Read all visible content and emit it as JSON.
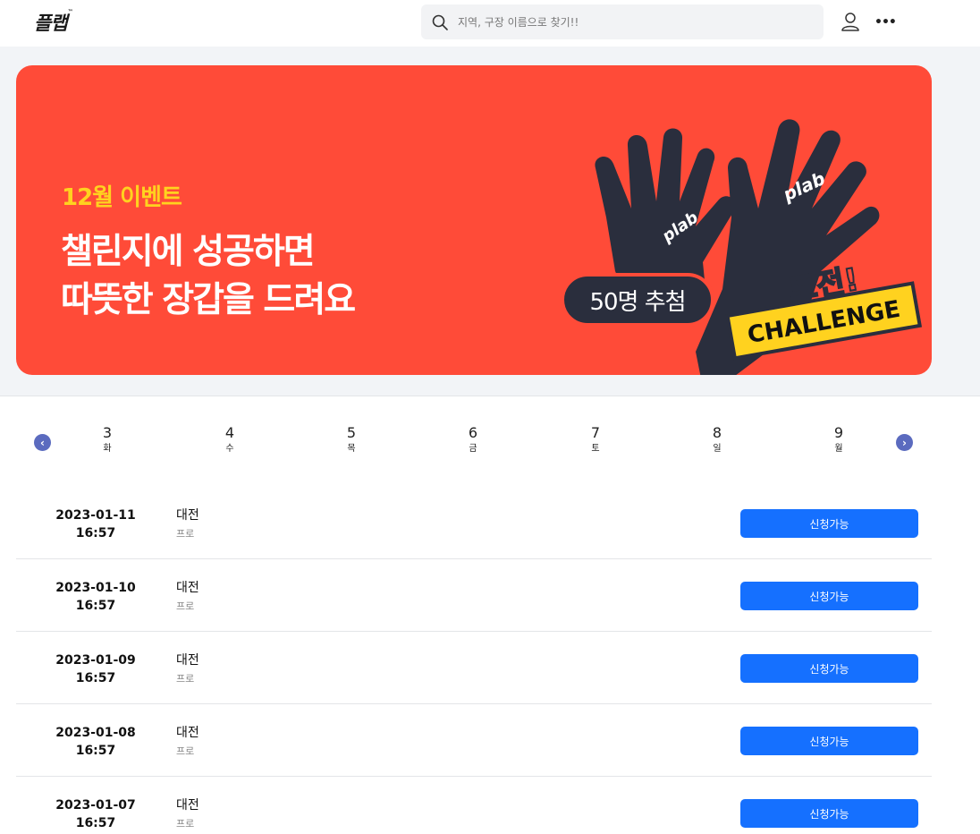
{
  "header": {
    "logo": "플랩",
    "logo_tm": "™",
    "search_placeholder": "지역, 구장 이름으로 찾기!!"
  },
  "banner": {
    "eyebrow": "12월 이벤트",
    "headline_line1": "챌린지에 성공하면",
    "headline_line2": "따뜻한 장갑을 드려요",
    "pill": "50명 추첨",
    "sticker_ko": "도전!",
    "sticker_en": "CHALLENGE",
    "glove_brand": "plab",
    "colors": {
      "background": "#ff4b38",
      "eyebrow": "#ffd21f",
      "glove": "#2a2e3d",
      "sticker": "#ffd21f"
    }
  },
  "dates": {
    "days": [
      {
        "num": "3",
        "weekday": "화"
      },
      {
        "num": "4",
        "weekday": "수"
      },
      {
        "num": "5",
        "weekday": "목"
      },
      {
        "num": "6",
        "weekday": "금"
      },
      {
        "num": "7",
        "weekday": "토"
      },
      {
        "num": "8",
        "weekday": "일"
      },
      {
        "num": "9",
        "weekday": "월"
      }
    ],
    "prev_icon": "chevron-left-icon",
    "next_icon": "chevron-right-icon"
  },
  "matches": [
    {
      "date": "2023-01-11",
      "time": "16:57",
      "place": "대전",
      "level": "프로",
      "status": "신청가능"
    },
    {
      "date": "2023-01-10",
      "time": "16:57",
      "place": "대전",
      "level": "프로",
      "status": "신청가능"
    },
    {
      "date": "2023-01-09",
      "time": "16:57",
      "place": "대전",
      "level": "프로",
      "status": "신청가능"
    },
    {
      "date": "2023-01-08",
      "time": "16:57",
      "place": "대전",
      "level": "프로",
      "status": "신청가능"
    },
    {
      "date": "2023-01-07",
      "time": "16:57",
      "place": "대전",
      "level": "프로",
      "status": "신청가능"
    }
  ],
  "accent_color": "#1570ff"
}
